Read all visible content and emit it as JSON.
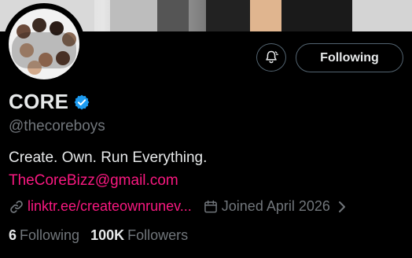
{
  "profile": {
    "display_name": "CORE",
    "handle": "@thecoreboys",
    "bio": "Create. Own. Run Everything.",
    "email": "TheCoreBizz@gmail.com",
    "link": "linktr.ee/createownrunev...",
    "joined": "Joined April 2026",
    "verified": true
  },
  "actions": {
    "follow_label": "Following",
    "bell_icon": "notification-bell-icon"
  },
  "stats": {
    "following_count": "6",
    "following_label": "Following",
    "followers_count": "100K",
    "followers_label": "Followers"
  },
  "colors": {
    "background": "#000000",
    "primary_text": "#e7e9ea",
    "secondary_text": "#71767b",
    "link_pink": "#f91880",
    "verified_blue": "#1d9bf0",
    "button_border": "#536471"
  }
}
